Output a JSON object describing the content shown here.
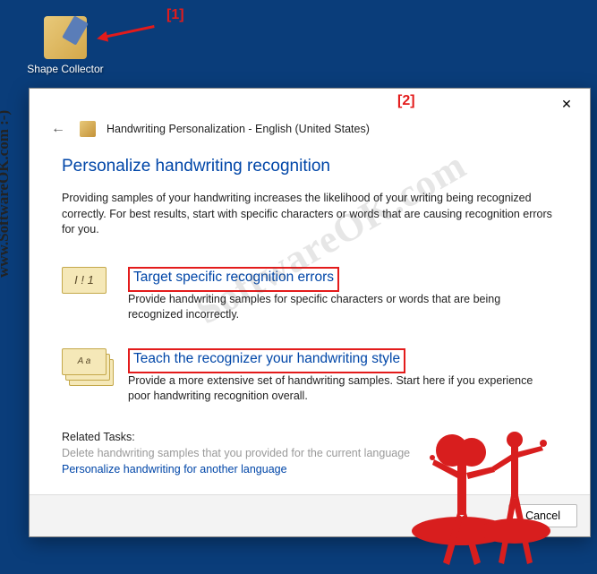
{
  "desktop": {
    "icon_label": "Shape Collector"
  },
  "annotations": {
    "label1": "[1]",
    "label2": "[2]"
  },
  "dialog": {
    "title": "Handwriting Personalization - English (United States)",
    "heading": "Personalize handwriting recognition",
    "intro": "Providing samples of your handwriting increases the likelihood of your writing being recognized correctly. For best results, start with specific characters or words that are causing recognition errors for you.",
    "option1": {
      "link": "Target specific recognition errors",
      "desc": "Provide handwriting samples for specific characters or words that are being recognized incorrectly."
    },
    "option2": {
      "link": "Teach the recognizer your handwriting style",
      "desc": "Provide a more extensive set of handwriting samples. Start here if you experience poor handwriting recognition overall."
    },
    "related": {
      "heading": "Related Tasks:",
      "disabled": "Delete handwriting samples that you provided for the current language",
      "link": "Personalize handwriting for another language"
    },
    "cancel": "Cancel"
  },
  "watermark": {
    "vertical": "www.SoftwareOK.com :-)",
    "diagonal": "SoftwareOK.com"
  }
}
